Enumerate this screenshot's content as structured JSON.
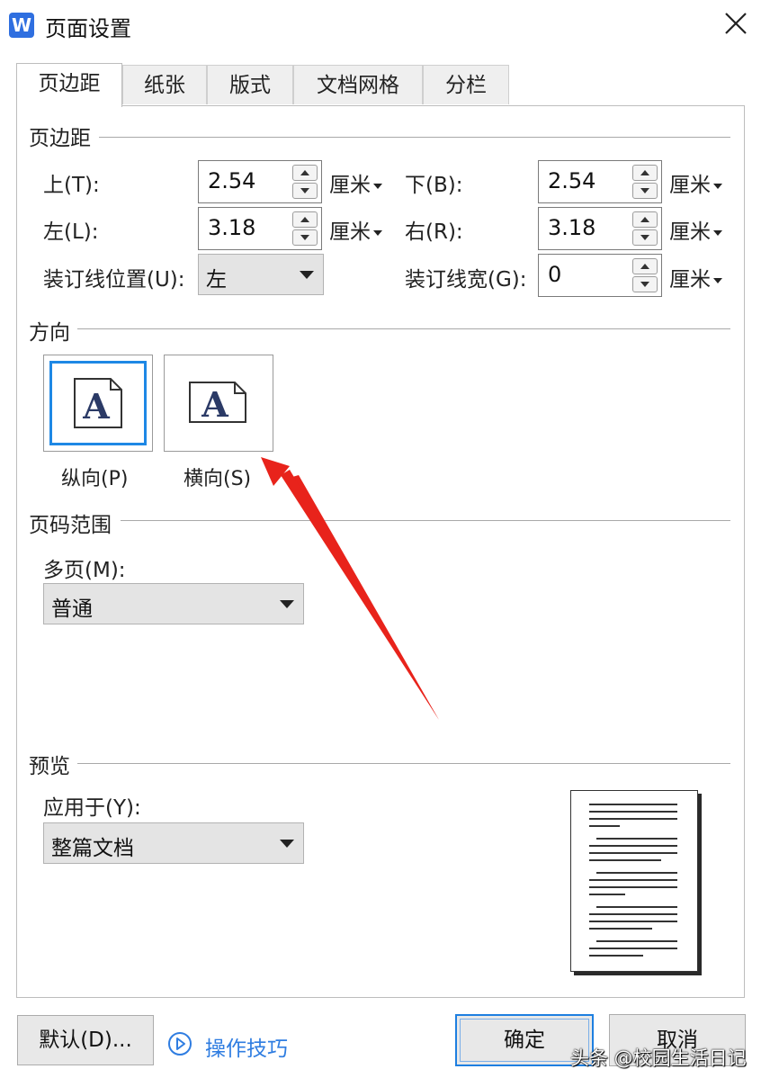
{
  "window": {
    "app_icon": "W",
    "title": "页面设置",
    "close_icon": "close-icon"
  },
  "tabs": [
    {
      "label": "页边距",
      "active": true
    },
    {
      "label": "纸张",
      "active": false
    },
    {
      "label": "版式",
      "active": false
    },
    {
      "label": "文档网格",
      "active": false
    },
    {
      "label": "分栏",
      "active": false
    }
  ],
  "margins": {
    "section_title": "页边距",
    "top_label": "上(T):",
    "top_value": "2.54",
    "top_unit": "厘米",
    "bottom_label": "下(B):",
    "bottom_value": "2.54",
    "bottom_unit": "厘米",
    "left_label": "左(L):",
    "left_value": "3.18",
    "left_unit": "厘米",
    "right_label": "右(R):",
    "right_value": "3.18",
    "right_unit": "厘米",
    "gutter_pos_label": "装订线位置(U):",
    "gutter_pos_value": "左",
    "gutter_width_label": "装订线宽(G):",
    "gutter_width_value": "0",
    "gutter_width_unit": "厘米"
  },
  "orientation": {
    "section_title": "方向",
    "portrait_label": "纵向(P)",
    "landscape_label": "横向(S)",
    "selected": "portrait",
    "page_letter": "A"
  },
  "page_range": {
    "section_title": "页码范围",
    "multi_label": "多页(M):",
    "multi_value": "普通"
  },
  "preview": {
    "section_title": "预览",
    "apply_label": "应用于(Y):",
    "apply_value": "整篇文档"
  },
  "footer": {
    "default_button": "默认(D)...",
    "tips_label": "操作技巧",
    "ok_button": "确定",
    "cancel_button": "取消"
  },
  "watermark": "头条 @校园生活日记",
  "colors": {
    "accent": "#1e88e5",
    "link": "#2f7de1",
    "arrow": "#e8231b"
  }
}
